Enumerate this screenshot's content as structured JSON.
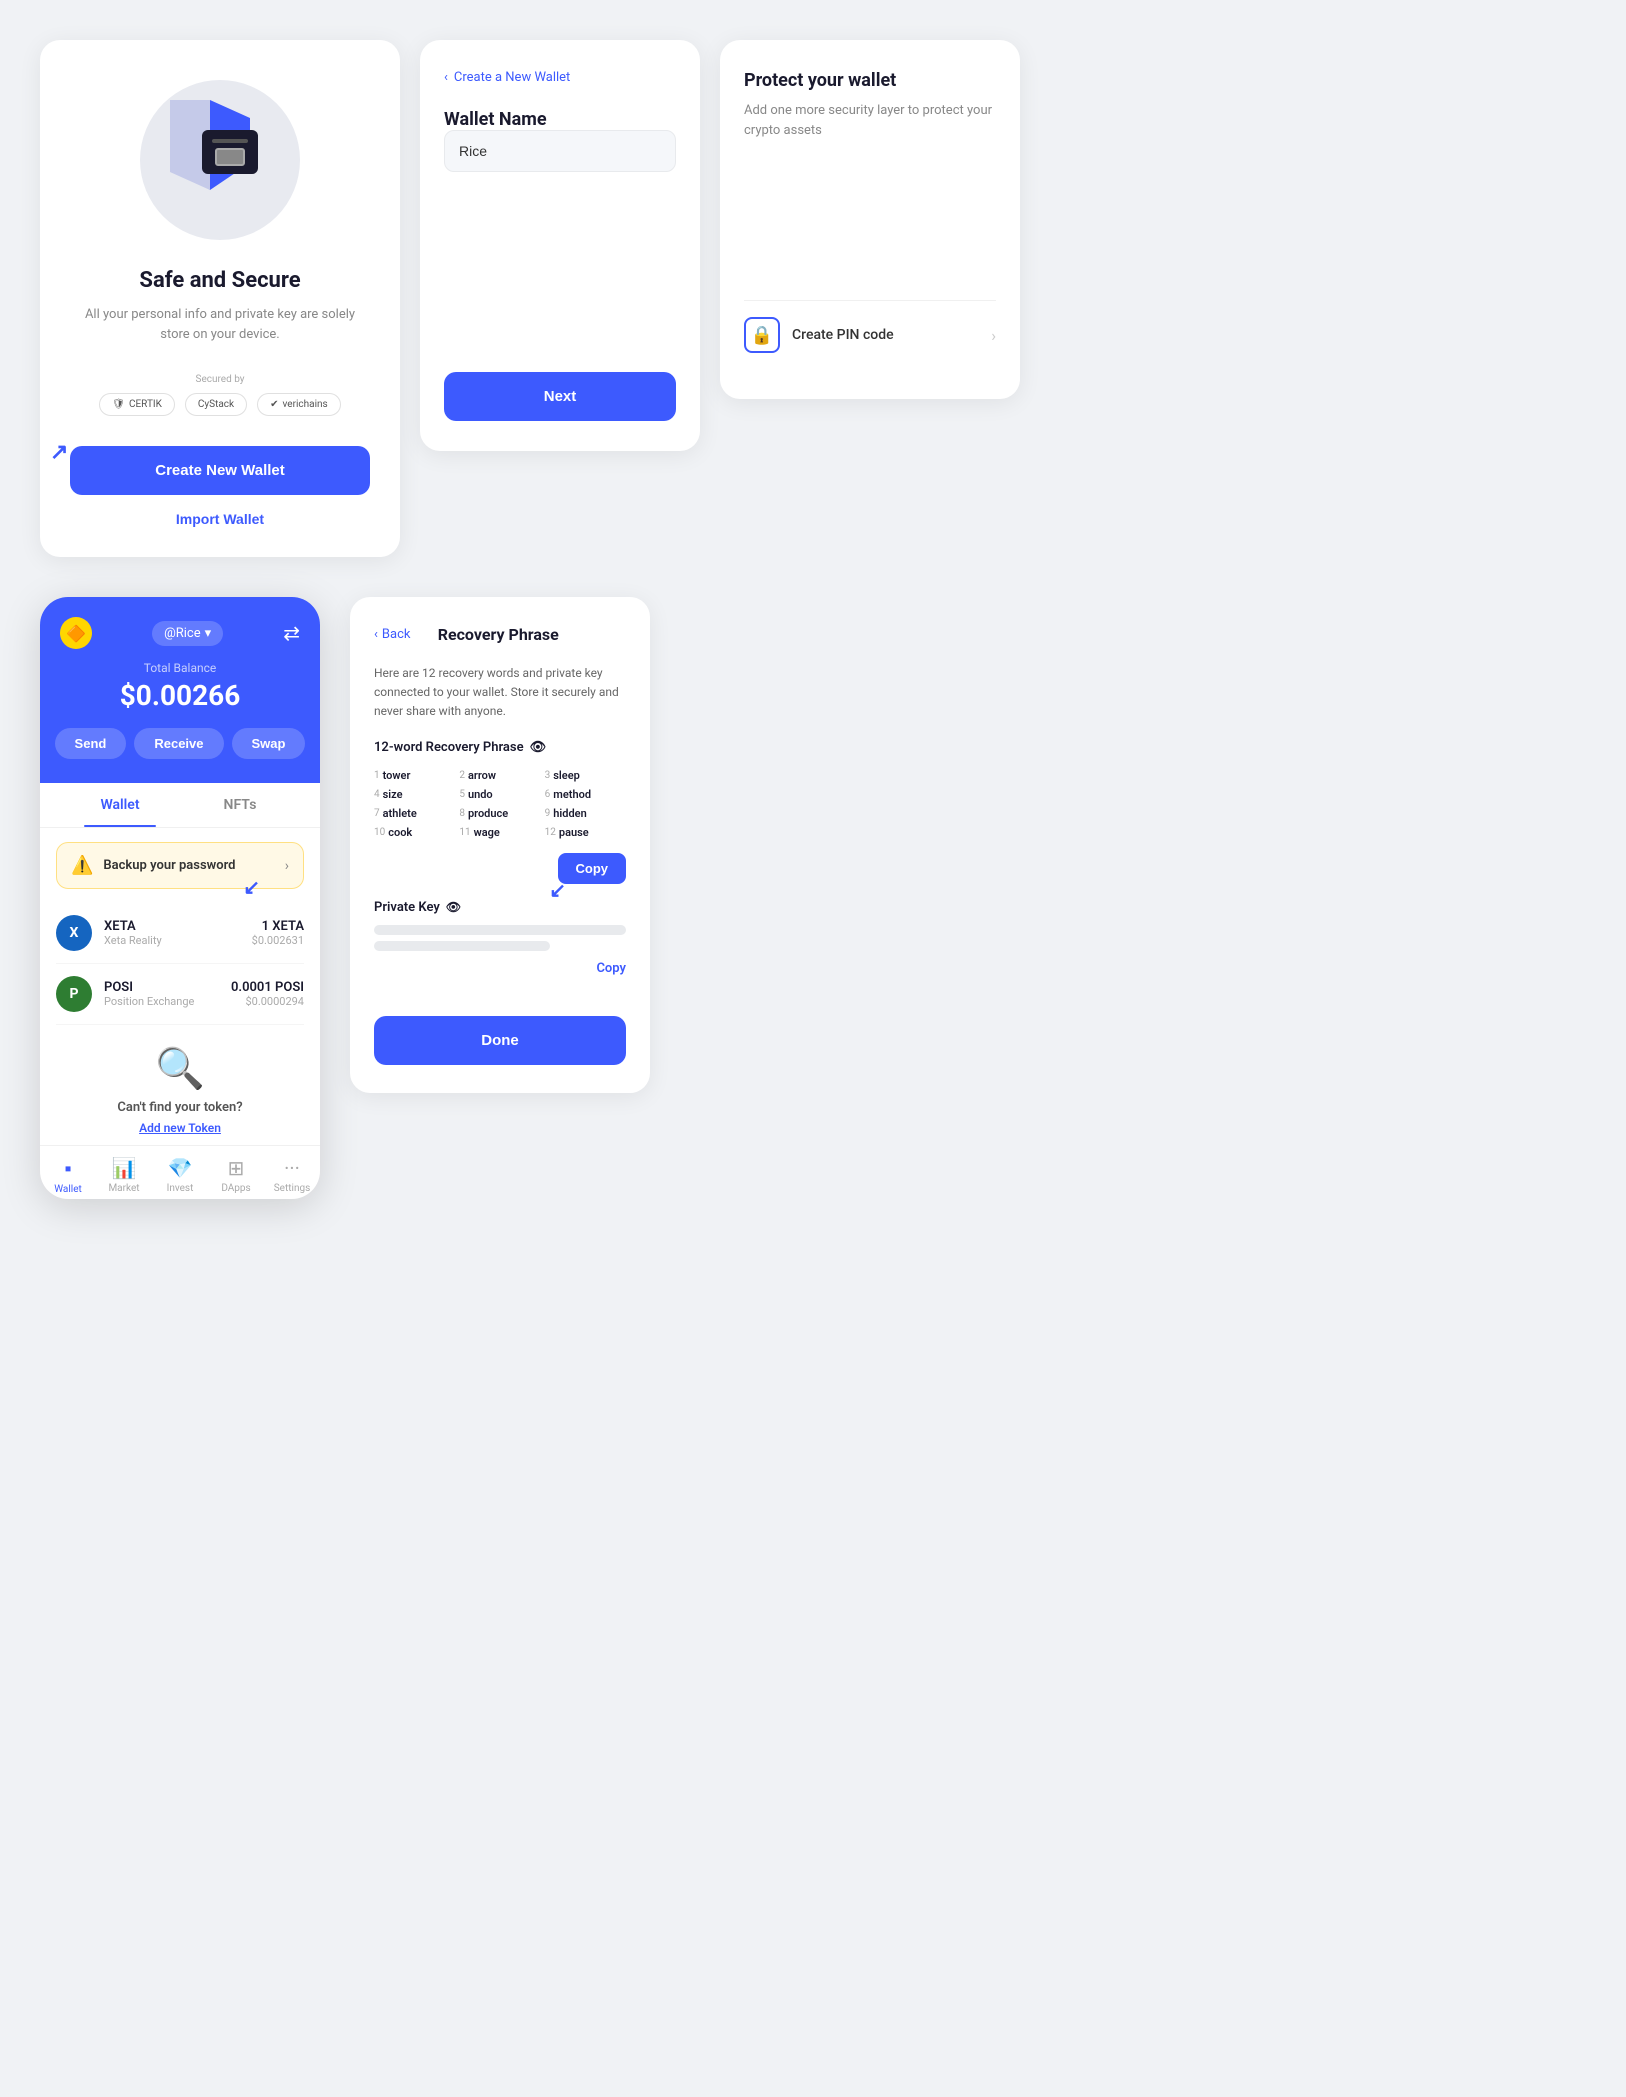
{
  "card_safe": {
    "title": "Safe and Secure",
    "description": "All your personal info and private key are solely store on your device.",
    "secured_by": "Secured by",
    "security_badges": [
      "certik",
      "CyStack",
      "verichains"
    ],
    "btn_create": "Create New Wallet",
    "btn_import": "Import Wallet"
  },
  "card_create": {
    "back_label": "Create a New Wallet",
    "form_label": "Wallet Name",
    "input_value": "Rice",
    "btn_next": "Next"
  },
  "card_protect": {
    "title": "Protect your wallet",
    "description": "Add one more security layer to protect your crypto assets",
    "pin_label": "Create PIN code"
  },
  "mobile_app": {
    "logo": "🔶",
    "account": "@Rice",
    "total_balance_label": "Total Balance",
    "total_balance": "$0.00266",
    "actions": [
      "Send",
      "Receive",
      "Swap"
    ],
    "tabs": [
      "Wallet",
      "NFTs"
    ],
    "backup_text": "Backup your password",
    "tokens": [
      {
        "symbol": "XETA",
        "name": "Xeta Reality",
        "amount": "1 XETA",
        "usd": "$0.002631",
        "color": "#1565C0",
        "icon": "X"
      },
      {
        "symbol": "POSI",
        "name": "Position Exchange",
        "amount": "0.0001 POSI",
        "usd": "$0.0000294",
        "color": "#2e7d32",
        "icon": "P"
      }
    ],
    "cant_find_text": "Can't find your token?",
    "add_token_link": "Add new Token",
    "nav_items": [
      "Wallet",
      "Market",
      "Invest",
      "DApps",
      "Settings"
    ]
  },
  "recovery": {
    "back_label": "Back",
    "title": "Recovery Phrase",
    "description": "Here are 12 recovery words and private key connected to your wallet. Store it securely and never share with anyone.",
    "phrase_label": "12-word Recovery Phrase",
    "words": [
      {
        "num": 1,
        "word": "tower"
      },
      {
        "num": 2,
        "word": "arrow"
      },
      {
        "num": 3,
        "word": "sleep"
      },
      {
        "num": 4,
        "word": "size"
      },
      {
        "num": 5,
        "word": "undo"
      },
      {
        "num": 6,
        "word": "method"
      },
      {
        "num": 7,
        "word": "athlete"
      },
      {
        "num": 8,
        "word": "produce"
      },
      {
        "num": 9,
        "word": "hidden"
      },
      {
        "num": 10,
        "word": "cook"
      },
      {
        "num": 11,
        "word": "wage"
      },
      {
        "num": 12,
        "word": "pause"
      }
    ],
    "copy_label": "Copy",
    "private_key_label": "Private Key",
    "private_key_copy": "Copy",
    "done_label": "Done"
  }
}
